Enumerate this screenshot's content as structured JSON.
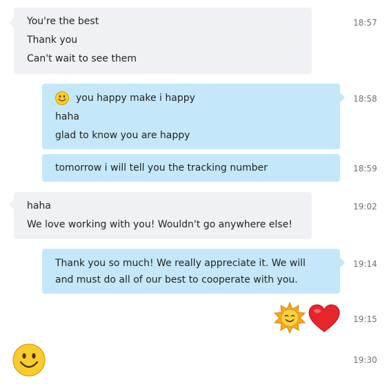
{
  "conversation": {
    "messages": [
      {
        "direction": "incoming",
        "lines": [
          "You're the best",
          "Thank you",
          "Can't wait to see them"
        ],
        "time": "18:57"
      },
      {
        "direction": "outgoing",
        "lines": [
          "you happy make i happy",
          "haha",
          "glad to know you are happy"
        ],
        "leading_emoticon": "smile-emoticon",
        "time": "18:58"
      },
      {
        "direction": "outgoing",
        "lines": [
          "tomorrow i will tell you the tracking number"
        ],
        "time": "18:59"
      },
      {
        "direction": "incoming",
        "lines": [
          "haha",
          "We love working with you! Wouldn't go anywhere else!"
        ],
        "time": "19:02"
      },
      {
        "direction": "outgoing",
        "lines": [
          "Thank you so much! We really appreciate it. We will",
          "and must do all of our best to cooperate with you."
        ],
        "time": "19:14"
      },
      {
        "direction": "outgoing",
        "emoticons": [
          "sun-emoticon",
          "heart-emoticon"
        ],
        "time": "19:15"
      },
      {
        "direction": "incoming",
        "emoticons": [
          "smile-emoticon"
        ],
        "time": "19:30"
      }
    ]
  },
  "colors": {
    "incoming_bubble": "#f0f1f5",
    "outgoing_bubble": "#c4e8f9",
    "timestamp": "#6f6f6f",
    "text": "#222222"
  }
}
